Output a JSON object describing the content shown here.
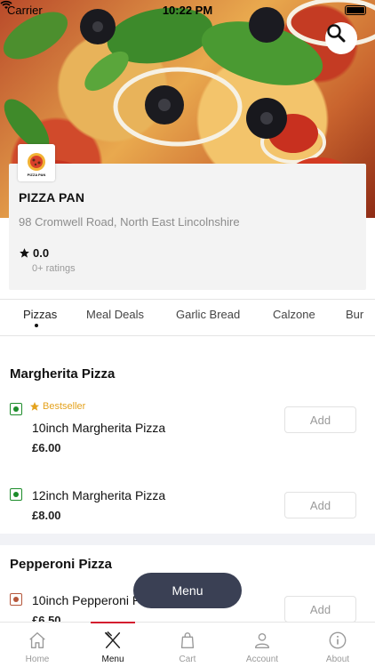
{
  "status_bar": {
    "carrier": "Carrier",
    "time": "10:22 PM"
  },
  "restaurant": {
    "logo_text": "PIZZA PAN",
    "name": "PIZZA PAN",
    "address": "98 Cromwell Road, North East Lincolnshire",
    "rating": "0.0",
    "ratings_count": "0+ ratings"
  },
  "tabs": [
    "Pizzas",
    "Meal Deals",
    "Garlic Bread",
    "Calzone",
    "Bur"
  ],
  "sections": [
    {
      "title": "Margherita Pizza",
      "items": [
        {
          "badge": "Bestseller",
          "name": "10inch Margherita Pizza",
          "price": "£6.00",
          "add": "Add"
        },
        {
          "name": "12inch Margherita Pizza",
          "price": "£8.00",
          "add": "Add"
        }
      ]
    },
    {
      "title": "Pepperoni Pizza",
      "items": [
        {
          "name": "10inch Pepperoni Pizza",
          "price": "£6.50",
          "add": "Add"
        }
      ]
    }
  ],
  "floating_menu": "Menu",
  "bottom_nav": [
    "Home",
    "Menu",
    "Cart",
    "Account",
    "About"
  ],
  "colors": {
    "accent": "#d41d2e",
    "veg": "#1c8c2a",
    "nonveg": "#b5563a",
    "bestseller": "#e4a21d",
    "menu_button": "#3a4054"
  },
  "icons": [
    "search-icon",
    "wifi-icon",
    "star-icon",
    "home-icon",
    "fork-knife-icon",
    "bag-icon",
    "user-icon",
    "info-icon"
  ]
}
